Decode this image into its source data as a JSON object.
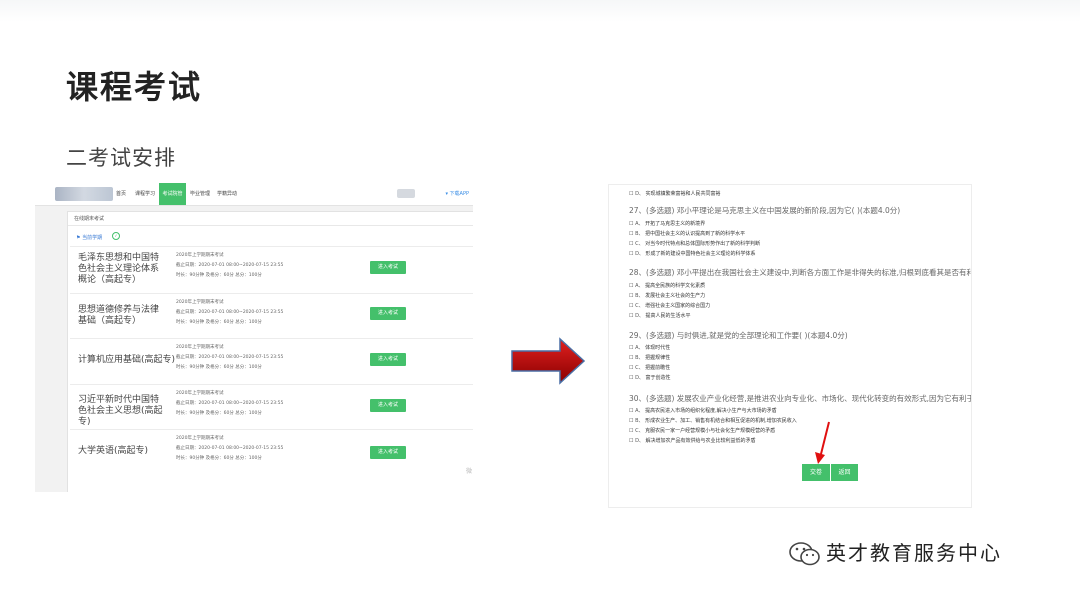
{
  "slide": {
    "title": "课程考试",
    "subtitle": "二考试安排",
    "brand": "英才教育服务中心"
  },
  "left_screen": {
    "nav": [
      {
        "label": "首页",
        "active": false
      },
      {
        "label": "课程学习",
        "active": false
      },
      {
        "label": "考试院管",
        "active": true
      },
      {
        "label": "毕业管理",
        "active": false
      },
      {
        "label": "学籍异动",
        "active": false
      }
    ],
    "nav_user": "",
    "nav_app": "▾ 下载APP",
    "panel_head": "在线期末考试",
    "flag_label": "当前学期",
    "courses": [
      {
        "name": "毛泽东思想和中国特色社会主义理论体系概论（高起专）",
        "term": "2020年上学期期末考试",
        "date": "截止日期：2020-07-01 08:00~2020-07-15 23:55",
        "limit": "时长：90分钟   及格分：60分   总分：100分",
        "button": "进入考试"
      },
      {
        "name": "思想道德修养与法律基础（高起专）",
        "term": "2020年上学期期末考试",
        "date": "截止日期：2020-07-01 08:00~2020-07-15 23:55",
        "limit": "时长：90分钟   及格分：60分   总分：100分",
        "button": "进入考试"
      },
      {
        "name": "计算机应用基础(高起专)",
        "term": "2020年上学期期末考试",
        "date": "截止日期：2020-07-01 08:00~2020-07-15 23:55",
        "limit": "时长：90分钟   及格分：60分   总分：100分",
        "button": "进入考试"
      },
      {
        "name": "习近平新时代中国特色社会主义思想(高起专)",
        "term": "2020年上学期期末考试",
        "date": "截止日期：2020-07-01 08:00~2020-07-15 23:55",
        "limit": "时长：90分钟   及格分：60分   总分：100分",
        "button": "进入考试"
      },
      {
        "name": "大学英语(高起专)",
        "term": "2020年上学期期末考试",
        "date": "截止日期：2020-07-01 08:00~2020-07-15 23:55",
        "limit": "时长：90分钟   及格分：60分   总分：100分",
        "button": "进入考试"
      }
    ],
    "watermark": "微"
  },
  "right_screen": {
    "top_option": {
      "key": "D、",
      "text": "实现城镇繁荣富裕和人民共同富裕"
    },
    "questions": [
      {
        "title": "27、(多选题) 邓小平理论是马克思主义在中国发展的新阶段,因为它( )(本题4.0分)",
        "options": [
          {
            "key": "A、",
            "text": "开拓了马克思主义的新境界"
          },
          {
            "key": "B、",
            "text": "把中国社会主义的认识提高到了新的科学水平"
          },
          {
            "key": "C、",
            "text": "对当今时代特点和总体国际形势作出了新的科学判断"
          },
          {
            "key": "D、",
            "text": "形成了新的建设中国特色社会主义理论的科学体系"
          }
        ]
      },
      {
        "title": "28、(多选题) 邓小平提出在我国社会主义建设中,判断各方面工作是非得失的标准,归根到底看其是否有利于( )(本题4.0分)",
        "options": [
          {
            "key": "A、",
            "text": "提高全民族的科学文化素质"
          },
          {
            "key": "B、",
            "text": "发展社会主义社会的生产力"
          },
          {
            "key": "C、",
            "text": "增强社会主义国家的综合国力"
          },
          {
            "key": "D、",
            "text": "提高人民的生活水平"
          }
        ]
      },
      {
        "title": "29、(多选题) 与时俱进,就是党的全部理论和工作要( )(本题4.0分)",
        "options": [
          {
            "key": "A、",
            "text": "体现时代性"
          },
          {
            "key": "B、",
            "text": "把握规律性"
          },
          {
            "key": "C、",
            "text": "把握前瞻性"
          },
          {
            "key": "D、",
            "text": "富于创造性"
          }
        ]
      },
      {
        "title": "30、(多选题) 发展农业产业化经营,是推进农业向专业化、市场化、现代化转变的有效形式,因为它有利于( )(本题4.0分)",
        "options": [
          {
            "key": "A、",
            "text": "提高农民进入市场的组织化程度,解决小生产与大市场的矛盾"
          },
          {
            "key": "B、",
            "text": "形成农业生产、加工、销售有机结合和相互促进的机制,增加农民收入"
          },
          {
            "key": "C、",
            "text": "克服农民一家一户经营规模小与社会化生产规模经营的矛盾"
          },
          {
            "key": "D、",
            "text": "解决增加农产品有效供给与农业比较利益低的矛盾"
          }
        ]
      }
    ],
    "submit": "交卷",
    "back": "返回"
  },
  "colors": {
    "accent": "#44c06b",
    "arrow": "#c00000",
    "link": "#3a8ee6"
  },
  "icons": [
    "wechat-icon",
    "flag-icon",
    "check-circle-icon",
    "red-arrow-icon"
  ]
}
